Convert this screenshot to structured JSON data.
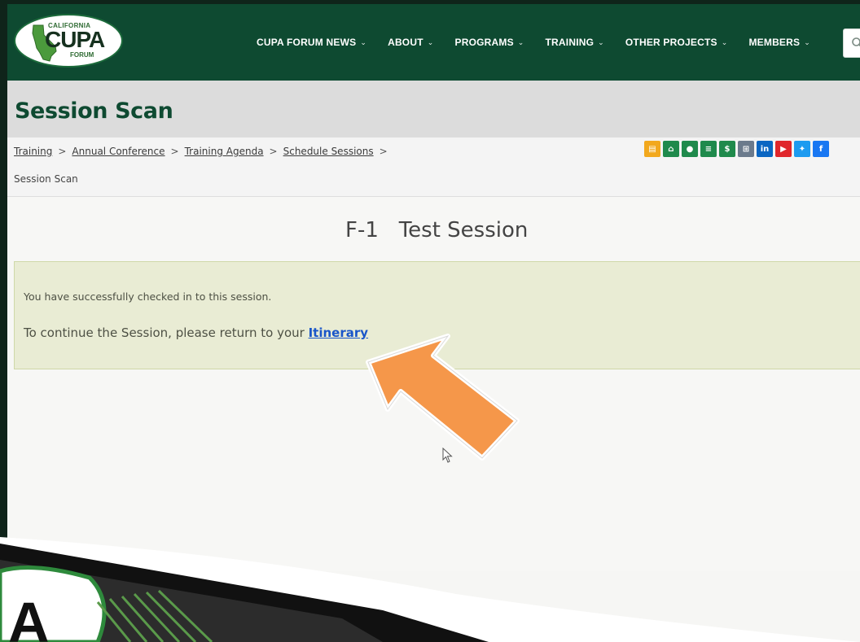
{
  "header": {
    "logo": {
      "top_text": "CALIFORNIA",
      "main_text": "CUPA",
      "bottom_text": "FORUM"
    },
    "nav": [
      {
        "label": "CUPA FORUM NEWS"
      },
      {
        "label": "ABOUT"
      },
      {
        "label": "PROGRAMS"
      },
      {
        "label": "TRAINING"
      },
      {
        "label": "OTHER PROJECTS"
      },
      {
        "label": "MEMBERS"
      }
    ],
    "search_icon": "search-icon"
  },
  "page": {
    "title": "Session Scan",
    "breadcrumb": [
      {
        "label": "Training"
      },
      {
        "label": "Annual Conference"
      },
      {
        "label": "Training Agenda"
      },
      {
        "label": "Schedule Sessions"
      }
    ],
    "breadcrumb_separator": ">",
    "breadcrumb_current": "Session Scan"
  },
  "social": [
    {
      "icon": "newspaper-icon",
      "glyph": "▤",
      "color": "#f2a81d"
    },
    {
      "icon": "home-icon",
      "glyph": "⌂",
      "color": "#1f8a4c"
    },
    {
      "icon": "user-icon",
      "glyph": "●",
      "color": "#1f8a4c"
    },
    {
      "icon": "list-icon",
      "glyph": "≡",
      "color": "#1f8a4c"
    },
    {
      "icon": "dollar-icon",
      "glyph": "$",
      "color": "#1f8a4c"
    },
    {
      "icon": "cart-icon",
      "glyph": "⊞",
      "color": "#6b7a8c"
    },
    {
      "icon": "linkedin-icon",
      "glyph": "in",
      "color": "#0a66c2"
    },
    {
      "icon": "youtube-icon",
      "glyph": "▶",
      "color": "#e0262b"
    },
    {
      "icon": "twitter-icon",
      "glyph": "✦",
      "color": "#1d9bf0"
    },
    {
      "icon": "facebook-icon",
      "glyph": "f",
      "color": "#1877f2"
    }
  ],
  "session": {
    "code": "F-1",
    "name": "Test Session"
  },
  "alert": {
    "line1": "You have successfully checked in to this session.",
    "line2_prefix": "To continue the Session, please return to your ",
    "link_label": "Itinerary"
  },
  "colors": {
    "header_bg": "#0e4a31",
    "title_color": "#0e4a31",
    "alert_bg": "#e9ecd4",
    "link": "#1a56c9",
    "arrow": "#f5974a"
  }
}
